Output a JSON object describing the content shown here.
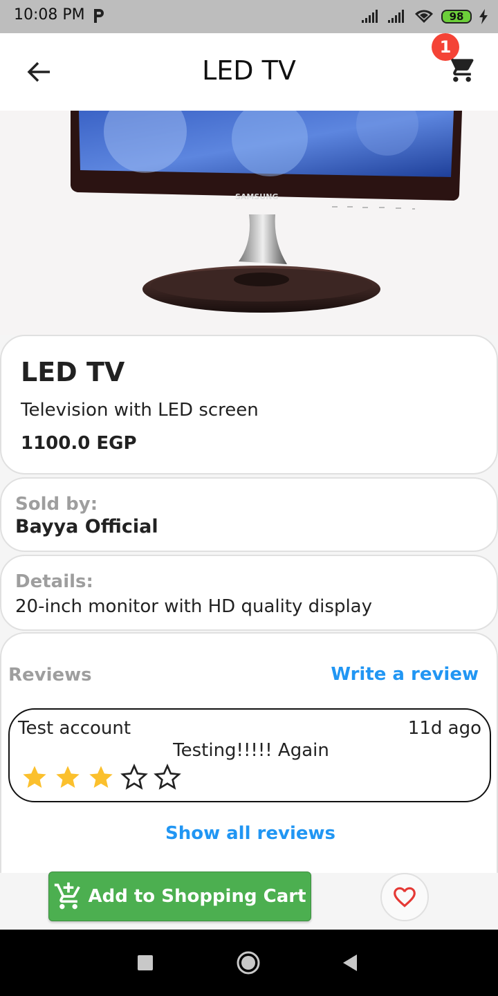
{
  "status_bar": {
    "time": "10:08 PM",
    "battery": "98",
    "icons": [
      "p-icon",
      "signal-icon",
      "signal-icon",
      "wifi-icon",
      "battery-icon",
      "charging-icon"
    ]
  },
  "app_bar": {
    "title": "LED TV",
    "cart_badge": "1",
    "icons": [
      "back-arrow-icon",
      "shopping-cart-icon"
    ]
  },
  "product": {
    "image_brand_text": "SAMSUNG",
    "name": "LED TV",
    "description": "Television with LED screen",
    "price": "1100.0 EGP"
  },
  "seller": {
    "label": "Sold by:",
    "name": "Bayya Official"
  },
  "details": {
    "label": "Details:",
    "text": "20-inch monitor with HD quality display"
  },
  "reviews": {
    "title": "Reviews",
    "write_label": "Write a review",
    "show_all_label": "Show all reviews",
    "items": [
      {
        "author": "Test account",
        "time": "11d ago",
        "text": "Testing!!!!! Again",
        "rating": 3,
        "max_rating": 5
      }
    ]
  },
  "actions": {
    "add_to_cart_label": "Add to Shopping Cart",
    "add_cart_icon": "add-cart-icon",
    "favorite_icon": "heart-icon"
  },
  "colors": {
    "accent_blue": "#2196f3",
    "button_green": "#4caf50",
    "badge_red": "#f44336",
    "star_yellow": "#fbc02d",
    "heart_red": "#e53935"
  }
}
